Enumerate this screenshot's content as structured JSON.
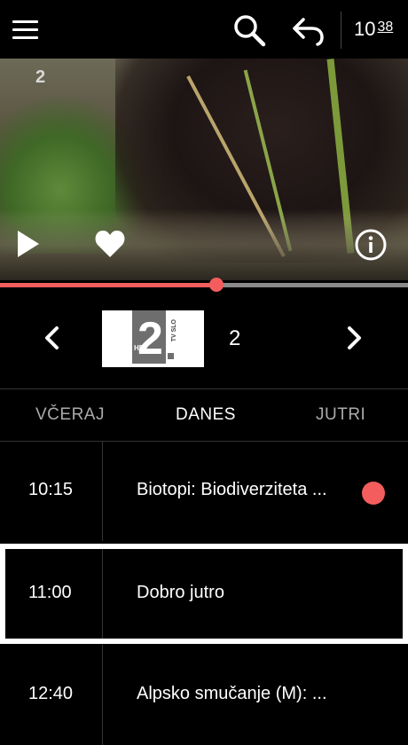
{
  "header": {
    "clock_hour": "10",
    "clock_minutes": "38"
  },
  "player": {
    "channel_watermark": "2",
    "progress": 0.53,
    "accent_color": "#f45d5d"
  },
  "channel": {
    "logo_number": "2",
    "logo_hd": "HD",
    "logo_tv": "TV SLO",
    "number": "2"
  },
  "tabs": [
    {
      "label": "VČERAJ"
    },
    {
      "label": "DANES"
    },
    {
      "label": "JUTRI"
    }
  ],
  "schedule": [
    {
      "time": "10:15",
      "title": "Biotopi: Biodiverziteta ...",
      "recording": true
    },
    {
      "time": "11:00",
      "title": "Dobro jutro",
      "selected": true
    },
    {
      "time": "12:40",
      "title": "Alpsko smučanje (M): ..."
    }
  ],
  "icons": {
    "menu": "menu-icon",
    "search": "search-icon",
    "back": "back-arrow-icon",
    "play": "play-icon",
    "favorite": "heart-icon",
    "info": "info-icon",
    "prev": "chevron-left-icon",
    "next": "chevron-right-icon"
  }
}
